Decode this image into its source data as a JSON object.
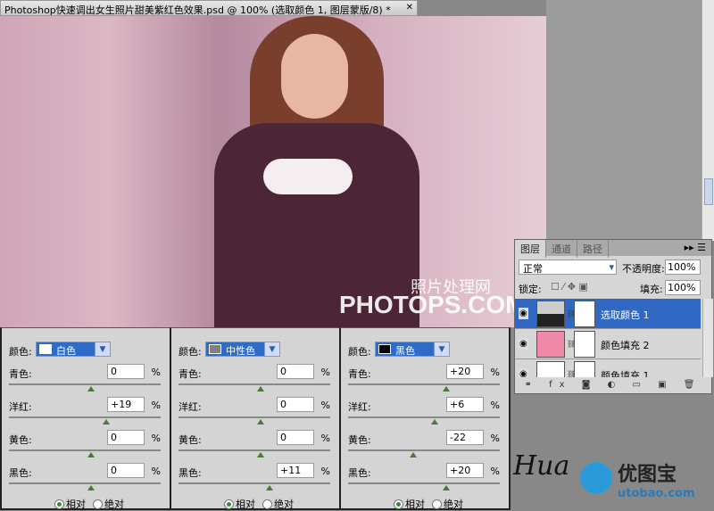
{
  "window": {
    "title": "Photoshop快速调出女生照片甜美紫红色效果.psd @ 100% (选取颜色 1, 图层蒙版/8) *",
    "close": "✕"
  },
  "watermark": {
    "cn": "照片处理网",
    "en": "PHOTOPS.COM"
  },
  "panels": [
    {
      "color_label": "颜色:",
      "color_value": "白色",
      "swatch": "#ffffff",
      "rows": [
        {
          "label": "青色:",
          "value": "0",
          "pos": 0
        },
        {
          "label": "洋红:",
          "value": "+19",
          "pos": 19
        },
        {
          "label": "黄色:",
          "value": "0",
          "pos": 0
        },
        {
          "label": "黑色:",
          "value": "0",
          "pos": 0
        }
      ],
      "relative": "相对",
      "absolute": "绝对",
      "mode": "relative"
    },
    {
      "color_label": "颜色:",
      "color_value": "中性色",
      "swatch": "#808080",
      "rows": [
        {
          "label": "青色:",
          "value": "0",
          "pos": 0
        },
        {
          "label": "洋红:",
          "value": "0",
          "pos": 0
        },
        {
          "label": "黄色:",
          "value": "0",
          "pos": 0
        },
        {
          "label": "黑色:",
          "value": "+11",
          "pos": 11
        }
      ],
      "relative": "相对",
      "absolute": "绝对",
      "mode": "relative"
    },
    {
      "color_label": "颜色:",
      "color_value": "黑色",
      "swatch": "#000000",
      "rows": [
        {
          "label": "青色:",
          "value": "+20",
          "pos": 20
        },
        {
          "label": "洋红:",
          "value": "+6",
          "pos": 6
        },
        {
          "label": "黄色:",
          "value": "-22",
          "pos": -22
        },
        {
          "label": "黑色:",
          "value": "+20",
          "pos": 20
        }
      ],
      "relative": "相对",
      "absolute": "绝对",
      "mode": "relative"
    }
  ],
  "percent": "%",
  "layers": {
    "tabs": [
      "图层",
      "通道",
      "路径"
    ],
    "blend": "正常",
    "opacity_label": "不透明度:",
    "opacity": "100%",
    "lock_label": "锁定:",
    "fill_label": "填充:",
    "fill": "100%",
    "items": [
      {
        "name": "选取颜色 1",
        "selected": true,
        "thumb": "adjustment"
      },
      {
        "name": "颜色填充 2",
        "selected": false,
        "thumb": "#f08aa8"
      },
      {
        "name": "颜色填充 1",
        "selected": false,
        "thumb": "#ffffff"
      }
    ],
    "footer_icons": [
      "link-icon",
      "fx-icon",
      "mask-icon",
      "adjustment-icon",
      "group-icon",
      "new-layer-icon",
      "trash-icon"
    ]
  },
  "logo": {
    "cn": "优图宝",
    "url": "utobao.com"
  }
}
